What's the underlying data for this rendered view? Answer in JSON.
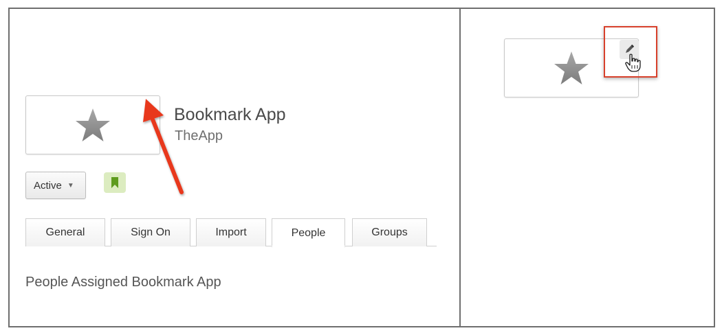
{
  "app": {
    "title": "Bookmark App",
    "subtitle": "TheApp"
  },
  "status": {
    "label": "Active"
  },
  "tabs": [
    {
      "label": "General",
      "active": false
    },
    {
      "label": "Sign On",
      "active": false
    },
    {
      "label": "Import",
      "active": false
    },
    {
      "label": "People",
      "active": true
    },
    {
      "label": "Groups",
      "active": false
    }
  ],
  "section": {
    "heading": "People Assigned Bookmark App"
  },
  "icons": {
    "logo": "star-icon",
    "status_caret": "caret-down-icon",
    "bookmark": "bookmark-icon",
    "edit": "pencil-icon",
    "cursor": "hand-pointer-icon",
    "annotation": "red-arrow-annotation"
  },
  "colors": {
    "highlight": "#d8402b",
    "bookmark_bg": "#dcecc0",
    "bookmark_fg": "#5e9b1d",
    "star": "#8c8c8c"
  }
}
